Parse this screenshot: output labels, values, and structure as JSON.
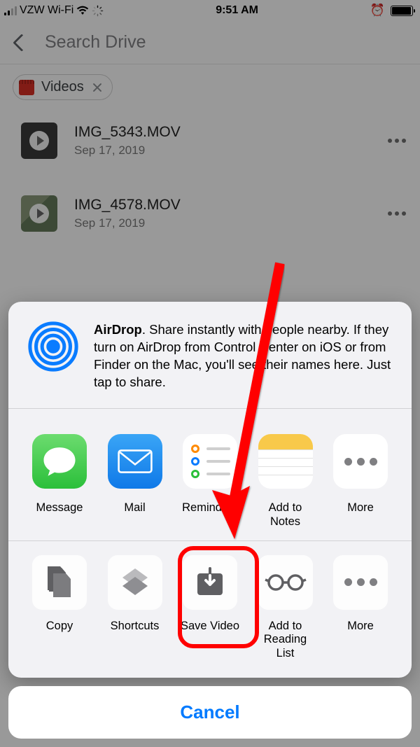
{
  "status": {
    "carrier": "VZW Wi-Fi",
    "time": "9:51 AM"
  },
  "search": {
    "placeholder": "Search Drive",
    "chipLabel": "Videos"
  },
  "files": [
    {
      "name": "IMG_5343.MOV",
      "date": "Sep 17, 2019"
    },
    {
      "name": "IMG_4578.MOV",
      "date": "Sep 17, 2019"
    }
  ],
  "airdrop": {
    "bold": "AirDrop",
    "text": ". Share instantly with people nearby. If they turn on AirDrop from Control Center on iOS or from Finder on the Mac, you'll see their names here. Just tap to share."
  },
  "shareApps": {
    "message": "Message",
    "mail": "Mail",
    "reminders": "Reminders",
    "notes": "Add to Notes",
    "more": "More"
  },
  "actions": {
    "copy": "Copy",
    "shortcuts": "Shortcuts",
    "save": "Save Video",
    "reading": "Add to Reading List",
    "more": "More"
  },
  "cancel": "Cancel"
}
